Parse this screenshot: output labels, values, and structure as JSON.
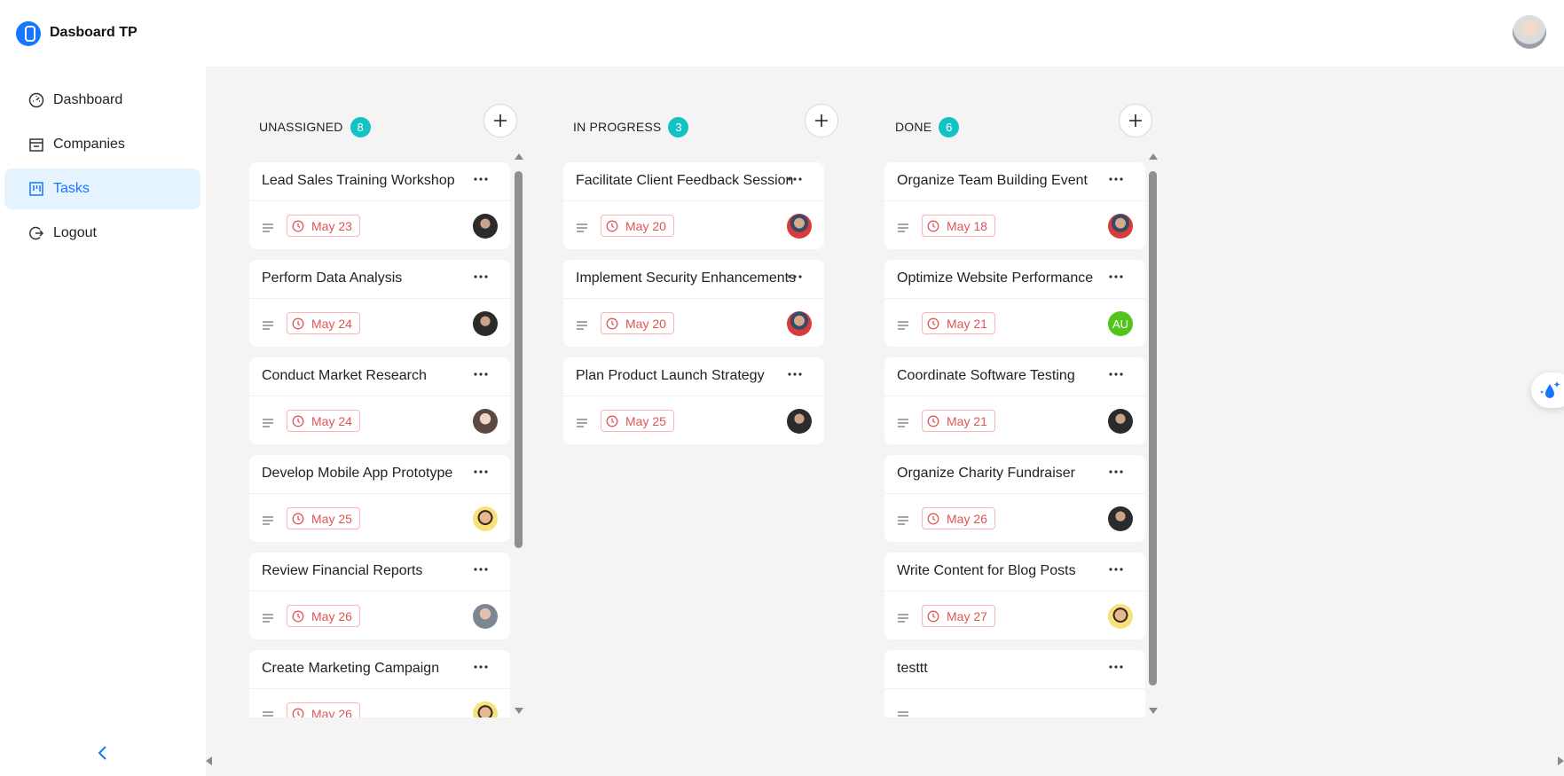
{
  "app": {
    "title": "Dasboard TP"
  },
  "sidebar": {
    "items": [
      {
        "label": "Dashboard",
        "icon": "dashboard-icon"
      },
      {
        "label": "Companies",
        "icon": "shop-icon"
      },
      {
        "label": "Tasks",
        "icon": "project-board-icon",
        "active": true
      },
      {
        "label": "Logout",
        "icon": "logout-icon"
      }
    ]
  },
  "colors": {
    "accent": "#1677ff",
    "count_badge": "#13c2c2",
    "date_text": "#e05555",
    "board_bg": "#f4f4f4"
  },
  "columns": [
    {
      "title": "UNASSIGNED",
      "count": "8",
      "cards": [
        {
          "title": "Lead Sales Training Workshop",
          "date": "May 23",
          "avatar": "dark"
        },
        {
          "title": "Perform Data Analysis",
          "date": "May 24",
          "avatar": "dark"
        },
        {
          "title": "Conduct Market Research",
          "date": "May 24",
          "avatar": "light"
        },
        {
          "title": "Develop Mobile App Prototype",
          "date": "May 25",
          "avatar": "yellow"
        },
        {
          "title": "Review Financial Reports",
          "date": "May 26",
          "avatar": "grey"
        },
        {
          "title": "Create Marketing Campaign",
          "date": "May 26",
          "avatar": "yellow"
        }
      ]
    },
    {
      "title": "IN PROGRESS",
      "count": "3",
      "cards": [
        {
          "title": "Facilitate Client Feedback Session",
          "date": "May 20",
          "avatar": "red"
        },
        {
          "title": "Implement Security Enhancements",
          "date": "May 20",
          "avatar": "red"
        },
        {
          "title": "Plan Product Launch Strategy",
          "date": "May 25",
          "avatar": "dark"
        }
      ]
    },
    {
      "title": "DONE",
      "count": "6",
      "cards": [
        {
          "title": "Organize Team Building Event",
          "date": "May 18",
          "avatar": "red"
        },
        {
          "title": "Optimize Website Performance",
          "date": "May 21",
          "initials": "AU"
        },
        {
          "title": "Coordinate Software Testing",
          "date": "May 21",
          "avatar": "dark"
        },
        {
          "title": "Organize Charity Fundraiser",
          "date": "May 26",
          "avatar": "dark"
        },
        {
          "title": "Write Content for Blog Posts",
          "date": "May 27",
          "avatar": "yellow"
        },
        {
          "title": "testtt",
          "date": "",
          "avatar": ""
        }
      ]
    }
  ]
}
